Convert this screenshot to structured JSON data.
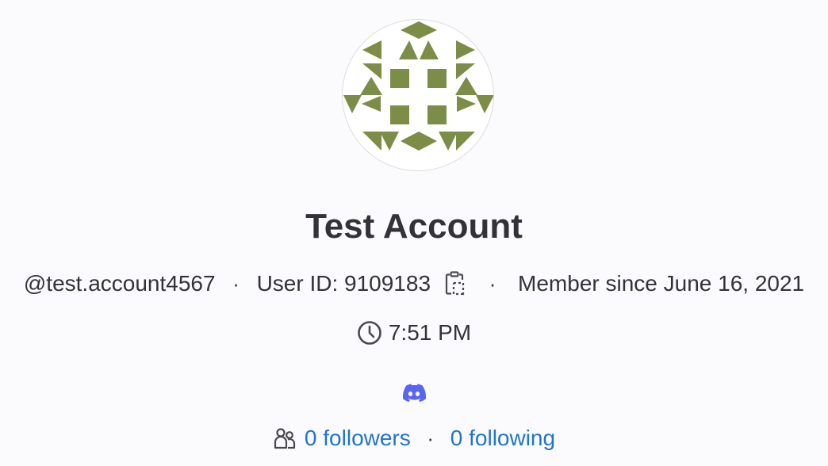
{
  "profile": {
    "display_name": "Test Account",
    "username": "@test.account4567",
    "user_id_label": "User ID: 9109183",
    "member_since": "Member since June 16, 2021",
    "separator": "·",
    "local_time": "7:51 PM",
    "followers": "0 followers",
    "following": "0 following"
  },
  "icons": {
    "avatar": "identicon-avatar",
    "copy": "copy-to-clipboard-icon",
    "clock": "clock-icon",
    "discord": "discord-icon",
    "users": "users-icon"
  },
  "colors": {
    "avatar_pattern": "#7c8d47",
    "discord": "#5865f2",
    "link": "#1f75cb",
    "text": "#333238",
    "background": "#fbfafd"
  }
}
